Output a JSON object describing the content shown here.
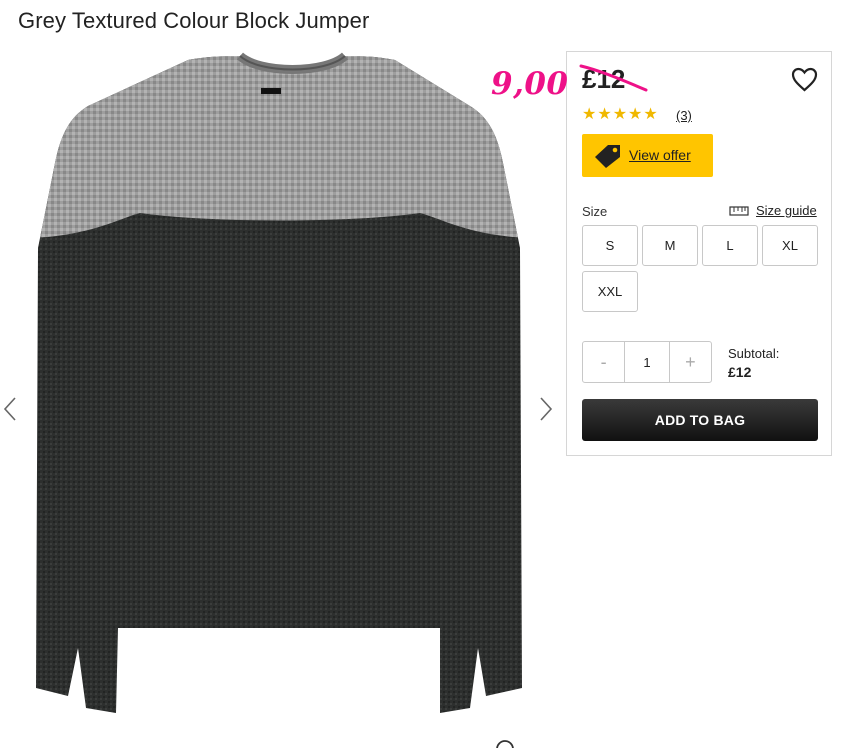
{
  "product": {
    "title": "Grey Textured Colour Block Jumper",
    "sale_price": "9,00",
    "price": "£12",
    "rating": 5,
    "review_count": "(3)"
  },
  "offer": {
    "label": "View offer"
  },
  "size": {
    "label": "Size",
    "guide_label": "Size guide",
    "options": [
      "S",
      "M",
      "L",
      "XL",
      "XXL"
    ]
  },
  "quantity": {
    "minus": "-",
    "value": "1",
    "plus": "+"
  },
  "subtotal": {
    "label": "Subtotal:",
    "value": "£12"
  },
  "cart": {
    "add_label": "ADD TO BAG"
  },
  "icons": {
    "wishlist": "heart-icon",
    "offer": "price-tag-icon",
    "size_guide": "ruler-icon",
    "prev": "chevron-left-icon",
    "next": "chevron-right-icon"
  },
  "colors": {
    "sale_price": "#ee1188",
    "offer_button": "#ffc500",
    "stars": "#f0b800",
    "add_button": "#1a1a1a"
  }
}
